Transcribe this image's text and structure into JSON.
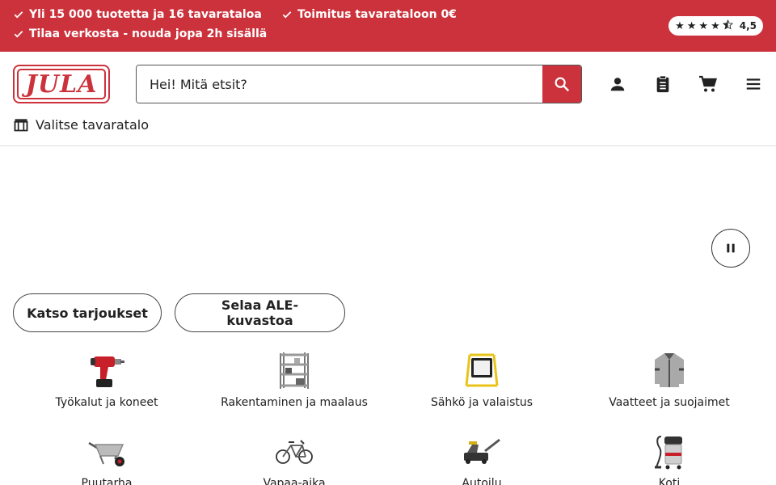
{
  "banner": {
    "usps": [
      "Yli 15 000 tuotetta ja 16 tavarataloa",
      "Toimitus tavarataloon 0€",
      "Tilaa verkosta - nouda jopa 2h sisällä"
    ],
    "rating": {
      "stars": 4.5,
      "score": "4,5"
    }
  },
  "header": {
    "logo_text": "JULA",
    "search": {
      "placeholder": "Hei! Mitä etsit?"
    },
    "icons": [
      "account-icon",
      "shopping-list-icon",
      "cart-icon",
      "menu-icon"
    ],
    "store_select": "Valitse tavaratalo"
  },
  "hero": {
    "pause_icon": "pause-icon"
  },
  "actions": {
    "offers": "Katso tarjoukset",
    "catalog": "Selaa ALE-kuvastoa"
  },
  "categories": [
    {
      "label": "Työkalut ja koneet",
      "icon": "drill-icon"
    },
    {
      "label": "Rakentaminen ja maalaus",
      "icon": "shelving-icon"
    },
    {
      "label": "Sähkö ja valaistus",
      "icon": "work-light-icon"
    },
    {
      "label": "Vaatteet ja suojaimet",
      "icon": "jacket-icon"
    },
    {
      "label": "Puutarha",
      "icon": "wheelbarrow-icon"
    },
    {
      "label": "Vapaa-aika",
      "icon": "bicycle-icon"
    },
    {
      "label": "Autoilu",
      "icon": "floor-jack-icon"
    },
    {
      "label": "Koti",
      "icon": "vacuum-icon"
    }
  ],
  "colors": {
    "brand_red": "#cc323c",
    "text": "#222222",
    "border": "#dcdcdc"
  }
}
